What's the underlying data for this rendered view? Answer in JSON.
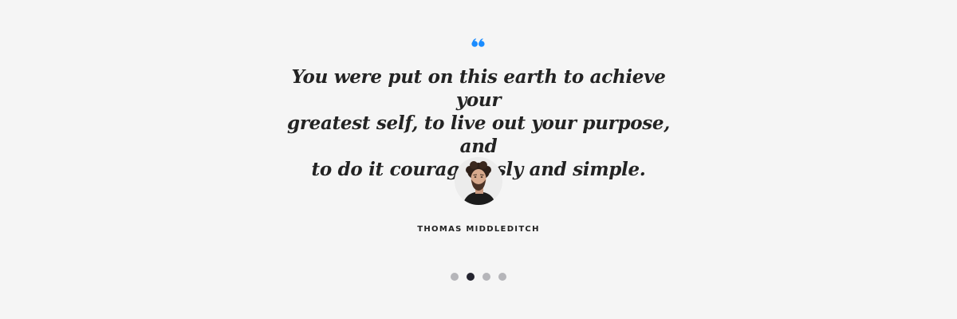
{
  "testimonial": {
    "quote_lines": [
      "You were put on this earth to achieve your",
      "greatest self, to live out your purpose, and",
      "to do it courageously and simple."
    ],
    "author": "THOMAS MIDDLEDITCH"
  },
  "icons": {
    "quote": "quote-mark-icon",
    "avatar": "author-avatar"
  },
  "colors": {
    "accent": "#1a8cff",
    "background": "#f5f5f5",
    "text": "#232323",
    "dot_inactive": "#b5b5b9",
    "dot_active": "#252530"
  },
  "carousel": {
    "slide_count": 4,
    "active_index": 1
  }
}
